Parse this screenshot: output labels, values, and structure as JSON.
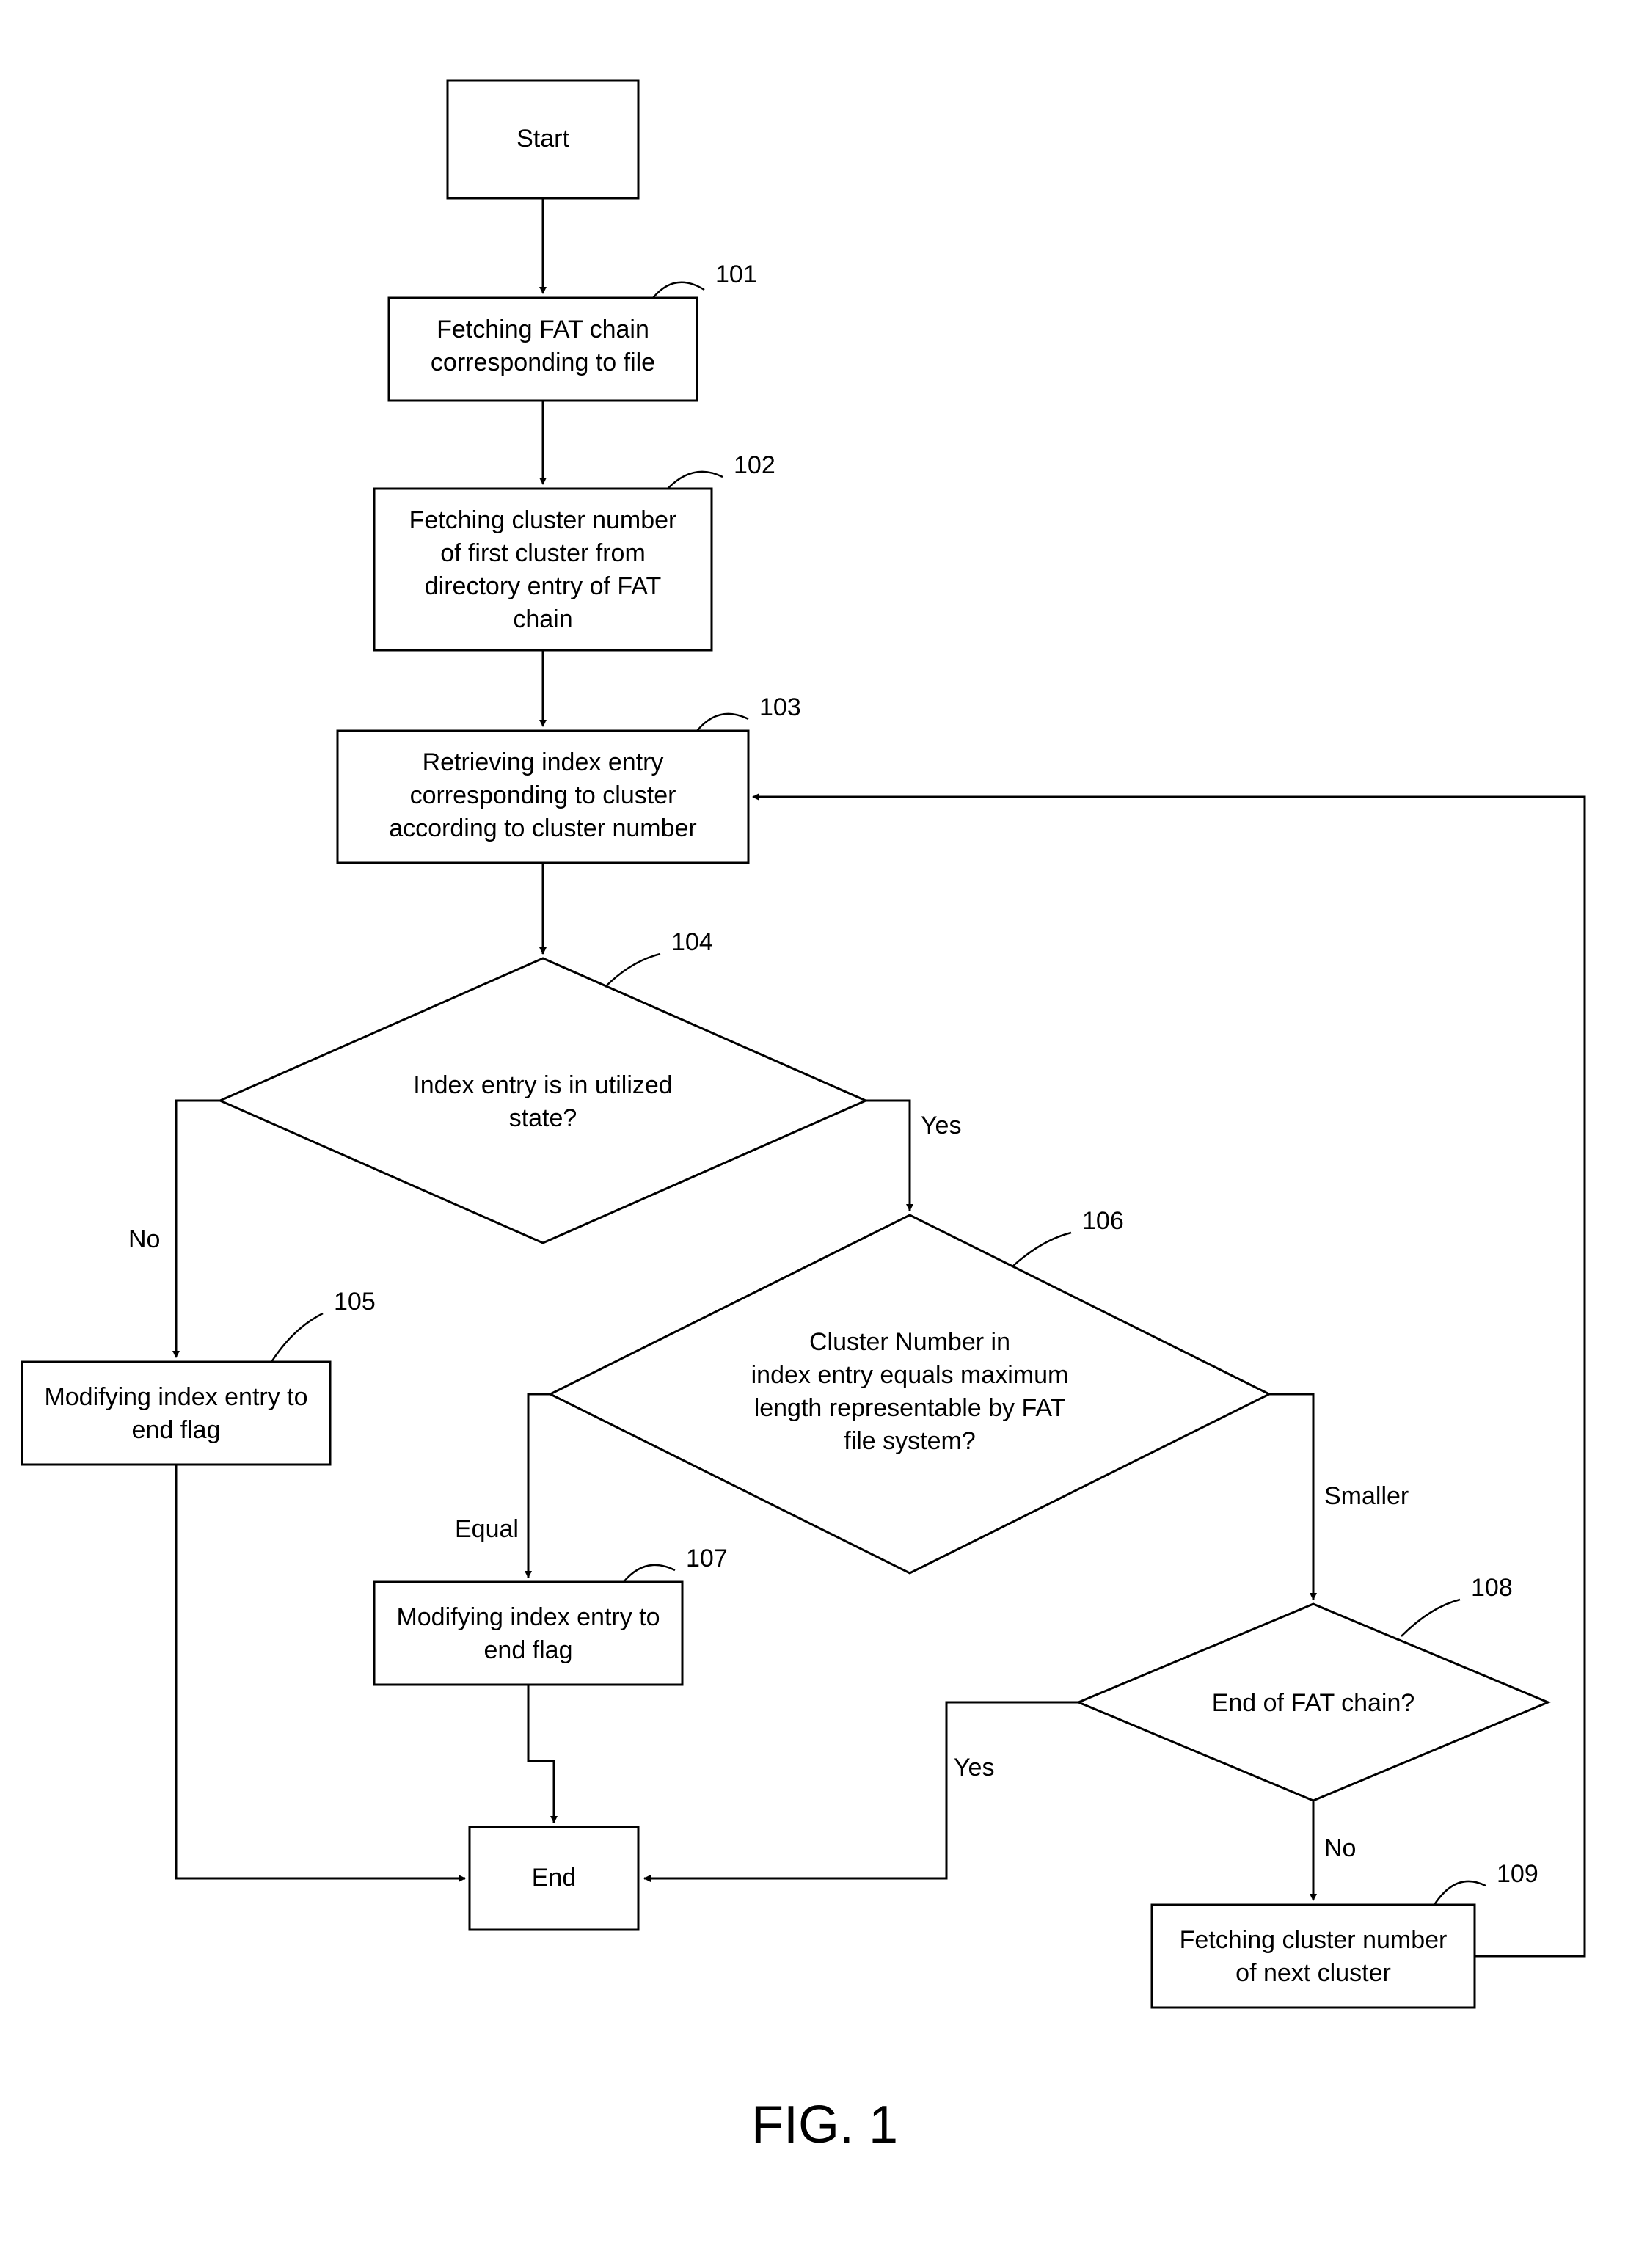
{
  "figure_label": "FIG. 1",
  "nodes": {
    "start": "Start",
    "n101_l1": "Fetching FAT chain",
    "n101_l2": "corresponding to file",
    "n102_l1": "Fetching cluster number",
    "n102_l2": "of first cluster from",
    "n102_l3": "directory entry of FAT",
    "n102_l4": "chain",
    "n103_l1": "Retrieving index entry",
    "n103_l2": "corresponding to cluster",
    "n103_l3": "according to cluster number",
    "n104_l1": "Index entry is in utilized",
    "n104_l2": "state?",
    "n105_l1": "Modifying index entry to",
    "n105_l2": "end flag",
    "n106_l1": "Cluster Number in",
    "n106_l2": "index entry equals maximum",
    "n106_l3": "length representable by FAT",
    "n106_l4": "file system?",
    "n107_l1": "Modifying index entry to",
    "n107_l2": "end flag",
    "n108": "End of FAT chain?",
    "n109_l1": "Fetching cluster number",
    "n109_l2": "of next cluster",
    "end": "End"
  },
  "edge_labels": {
    "yes": "Yes",
    "no": "No",
    "equal": "Equal",
    "smaller": "Smaller"
  },
  "refs": {
    "r101": "101",
    "r102": "102",
    "r103": "103",
    "r104": "104",
    "r105": "105",
    "r106": "106",
    "r107": "107",
    "r108": "108",
    "r109": "109"
  }
}
